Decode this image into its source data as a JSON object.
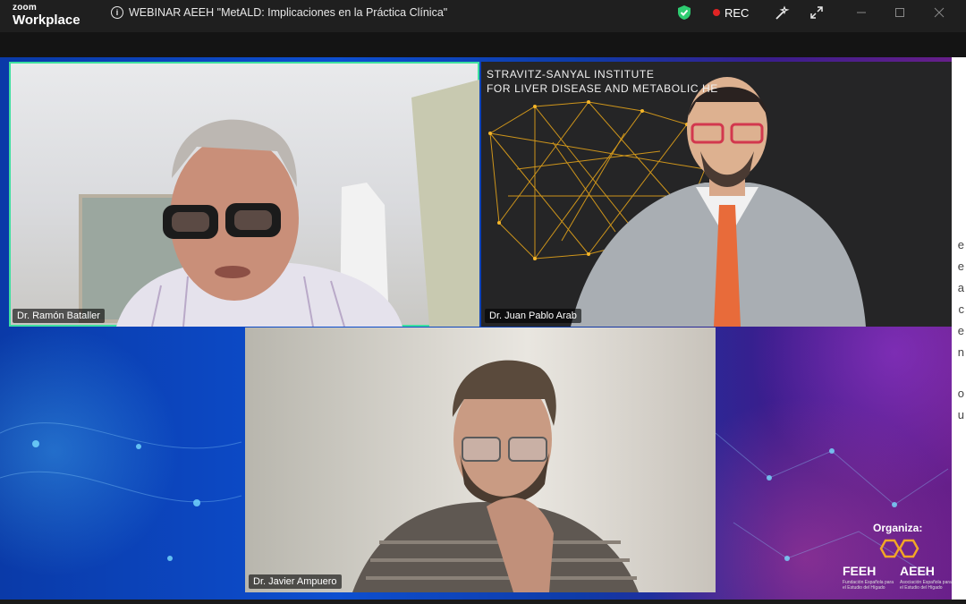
{
  "app": {
    "brand_top": "zoom",
    "brand_bottom": "Workplace"
  },
  "meeting": {
    "title": "WEBINAR AEEH \"MetALD: Implicaciones en la Práctica Clínica\""
  },
  "recording": {
    "label": "REC",
    "color": "#e02424"
  },
  "accent": {
    "active_speaker": "#3ee0a0",
    "shield": "#2ecc71"
  },
  "participants": [
    {
      "name": "Dr. Ramón Bataller",
      "active": true
    },
    {
      "name": "Dr. Juan Pablo Arab",
      "active": false
    },
    {
      "name": "Dr. Javier Ampuero",
      "active": false
    }
  ],
  "background_text": {
    "line1": "STRAVITZ-SANYAL INSTITUTE",
    "line2": "FOR LIVER DISEASE AND METABOLIC HE"
  },
  "right_strip_chars": [
    "e",
    "e",
    "a",
    "c",
    "e",
    "n",
    "o",
    "u"
  ],
  "organizer": {
    "label": "Organiza:",
    "left_name": "FEEH",
    "left_sub": "Fundación Española para el Estudio del Hígado",
    "right_name": "AEEH",
    "right_sub": "Asociación Española para el Estudio del Hígado"
  }
}
